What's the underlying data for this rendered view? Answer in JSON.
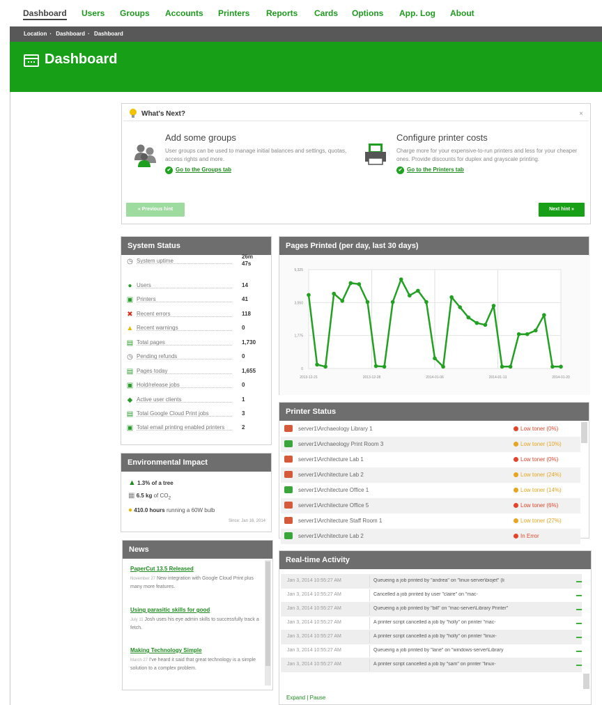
{
  "nav": {
    "items": [
      "Dashboard",
      "Users",
      "Groups",
      "Accounts",
      "Printers",
      "Reports",
      "Cards",
      "Options",
      "App. Log",
      "About"
    ],
    "active": "Dashboard"
  },
  "breadcrumb": [
    "Location",
    "Dashboard",
    "Dashboard"
  ],
  "page_title": "Dashboard",
  "whats_next": {
    "title": "What's Next?",
    "close": "×",
    "tips": [
      {
        "heading": "Add some groups",
        "text": "User groups can be used to manage initial balances and settings, quotas, access rights and more.",
        "link": "Go to the Groups tab"
      },
      {
        "heading": "Configure printer costs",
        "text": "Charge more for your expensive-to-run printers and less for your cheaper ones. Provide discounts for duplex and grayscale printing.",
        "link": "Go to the Printers tab"
      }
    ],
    "prev_label": "« Previous hint",
    "next_label": "Next hint »"
  },
  "system_status": {
    "title": "System Status",
    "rows": [
      {
        "icon": "clock-icon",
        "label": "System uptime",
        "value": "26m 47s"
      },
      {
        "icon": "users-icon",
        "label": "Users",
        "value": "14"
      },
      {
        "icon": "printer-icon",
        "label": "Printers",
        "value": "41"
      },
      {
        "icon": "error-icon",
        "label": "Recent errors",
        "value": "118"
      },
      {
        "icon": "warning-icon",
        "label": "Recent warnings",
        "value": "0"
      },
      {
        "icon": "pages-icon",
        "label": "Total pages",
        "value": "1,730"
      },
      {
        "icon": "refund-icon",
        "label": "Pending refunds",
        "value": "0"
      },
      {
        "icon": "pages-icon",
        "label": "Pages today",
        "value": "1,655"
      },
      {
        "icon": "hold-icon",
        "label": "Hold/release jobs",
        "value": "0"
      },
      {
        "icon": "client-icon",
        "label": "Active user clients",
        "value": "1"
      },
      {
        "icon": "cloud-icon",
        "label": "Total Google Cloud Print jobs",
        "value": "3"
      },
      {
        "icon": "email-icon",
        "label": "Total email printing enabled printers",
        "value": "2"
      }
    ]
  },
  "environment": {
    "title": "Environmental Impact",
    "trees": "1.3% of a tree",
    "co2_value": "6.5 kg",
    "co2_label": "of CO",
    "co2_sub": "2",
    "hours_value": "410.0 hours",
    "hours_label": "running a 60W bulb",
    "since": "Since: Jan 16, 2014"
  },
  "news": {
    "title": "News",
    "items": [
      {
        "title": "PaperCut 13.5 Released",
        "date": "November 27",
        "text": "New integration with Google Cloud Print plus many more features."
      },
      {
        "title": "Using parasitic skills for good",
        "date": "July 11",
        "text": "Josh uses his eye admin skills to successfully track a fetch."
      },
      {
        "title": "Making Technology Simple",
        "date": "March 27",
        "text": "I've heard it said that great technology is a simple solution to a complex problem."
      }
    ]
  },
  "chart_data": {
    "type": "line",
    "title": "Pages Printed (per day, last 30 days)",
    "x_tick_labels": [
      "2013-12-21",
      "2013-12-28",
      "2014-01-06",
      "2014-01-13",
      "2014-01-20"
    ],
    "y_tick_labels": [
      "0",
      "1,775",
      "3,550",
      "5,325"
    ],
    "ylim": [
      0,
      5325
    ],
    "color": "#22a022",
    "grid": true,
    "values": [
      3960,
      210,
      100,
      4030,
      3640,
      4600,
      4540,
      3580,
      130,
      100,
      3580,
      4800,
      3930,
      4190,
      3580,
      550,
      100,
      3840,
      3300,
      2750,
      2450,
      2350,
      3380,
      100,
      100,
      1850,
      1850,
      2050,
      2880,
      100,
      100
    ]
  },
  "printer_status": {
    "title": "Printer Status",
    "rows": [
      {
        "name": "server1\\Archaeology Library 1",
        "status": "Low toner (0%)",
        "level": "error"
      },
      {
        "name": "server1\\Archaeology Print Room 3",
        "status": "Low toner (10%)",
        "level": "warn"
      },
      {
        "name": "server1\\Architecture Lab 1",
        "status": "Low toner (0%)",
        "level": "error"
      },
      {
        "name": "server1\\Architecture Lab 2",
        "status": "Low toner (24%)",
        "level": "warn"
      },
      {
        "name": "server1\\Architecture Office 1",
        "status": "Low toner (14%)",
        "level": "warn"
      },
      {
        "name": "server1\\Architecture Office 5",
        "status": "Low toner (6%)",
        "level": "error"
      },
      {
        "name": "server1\\Architecture Staff Room 1",
        "status": "Low toner (27%)",
        "level": "warn"
      },
      {
        "name": "server1\\Architecture Lab 2",
        "status": "In Error",
        "level": "error"
      }
    ]
  },
  "realtime": {
    "title": "Real-time Activity",
    "rows": [
      {
        "time": "Jan 3, 2014 10:55:27 AM",
        "message": "Queueing a job printed by \"andrea\" on \"linux-server\\biojet\" (li"
      },
      {
        "time": "Jan 3, 2014 10:55:27 AM",
        "message": "Cancelled a job printed by user \"claire\" on \"mac-"
      },
      {
        "time": "Jan 3, 2014 10:55:27 AM",
        "message": "Queueing a job printed by \"bill\" on \"mac-server\\Library Printer\""
      },
      {
        "time": "Jan 3, 2014 10:55:27 AM",
        "message": "A printer script cancelled a job by \"holly\" on printer \"mac-"
      },
      {
        "time": "Jan 3, 2014 10:55:27 AM",
        "message": "A printer script cancelled a job by \"holly\" on printer \"linux-"
      },
      {
        "time": "Jan 3, 2014 10:55:27 AM",
        "message": "Queueing a job printed by \"lane\" on \"windows-server\\Library"
      },
      {
        "time": "Jan 3, 2014 10:55:27 AM",
        "message": "A printer script cancelled a job by \"sam\" on printer \"linux-"
      }
    ],
    "footer_expand": "Expand",
    "footer_sep": " | ",
    "footer_pause": "Pause"
  },
  "colors": {
    "brand_green": "#17a017",
    "header_gray": "#6e6e6e",
    "error_red": "#e3442a",
    "warn_orange": "#e8a520"
  }
}
